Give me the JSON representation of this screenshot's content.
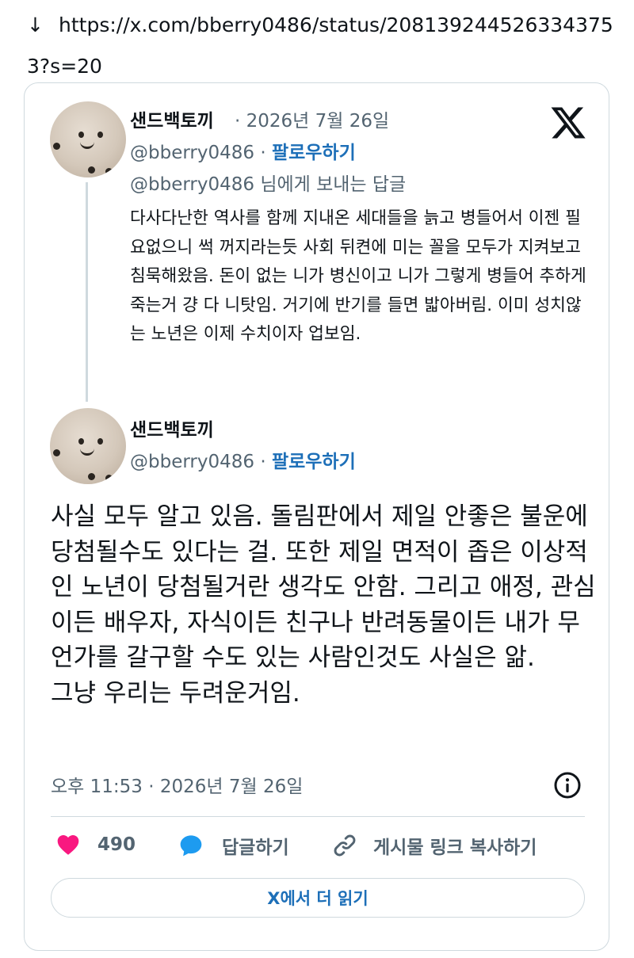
{
  "url_bar": {
    "arrow": "↓",
    "url": "https://x.com/bberry0486/status/2081392445263343753?s=20"
  },
  "reply_tweet": {
    "author_name": "샌드백토끼",
    "date": " · 2026년 7월 26일",
    "handle": "@bberry0486",
    "separator": " · ",
    "follow_label": "팔로우하기",
    "reply_to": "@bberry0486 님에게 보내는 답글",
    "text": "다사다난한 역사를 함께 지내온 세대들을 늙고 병들어서 이젠 필요없으니 썩 꺼지라는듯 사회 뒤켠에 미는 꼴을 모두가 지켜보고 침묵해왔음. 돈이 없는 니가 병신이고 니가 그렇게 병들어 추하게 죽는거 걍 다 니탓임. 거기에 반기를 들면 밟아버림. 이미 성치않는 노년은 이제 수치이자 업보임."
  },
  "main_tweet": {
    "author_name": "샌드백토끼",
    "handle": "@bberry0486",
    "separator": " · ",
    "follow_label": "팔로우하기",
    "text_lines": [
      "사실 모두 알고 있음. 돌림판에서 제일 안좋은 불운에 당첨될수도 있다는 걸. 또한 제일 면적이 좁은 이상적인 노년이 당첨될거란 생각도 안함. 그리고 애정, 관심이든 배우자, 자식이든 친구나 반려동물이든 내가 무언가를 갈구할 수도 있는 사람인것도 사실은 앎.",
      "그냥 우리는 두려운거임."
    ],
    "timestamp": "오후 11:53 · 2026년 7월 26일"
  },
  "actions": {
    "like_count": "490",
    "reply_label": "답글하기",
    "copy_link_label": "게시물 링크 복사하기"
  },
  "read_more_label": "X에서 더 읽기",
  "colors": {
    "accent": "#1d6fb8",
    "heart": "#f91880",
    "bubble": "#1d9bf0",
    "muted": "#536471",
    "border": "#cfd9de"
  },
  "icons": [
    "download-arrow-icon",
    "x-logo-icon",
    "info-icon",
    "heart-icon",
    "reply-bubble-icon",
    "link-icon"
  ]
}
